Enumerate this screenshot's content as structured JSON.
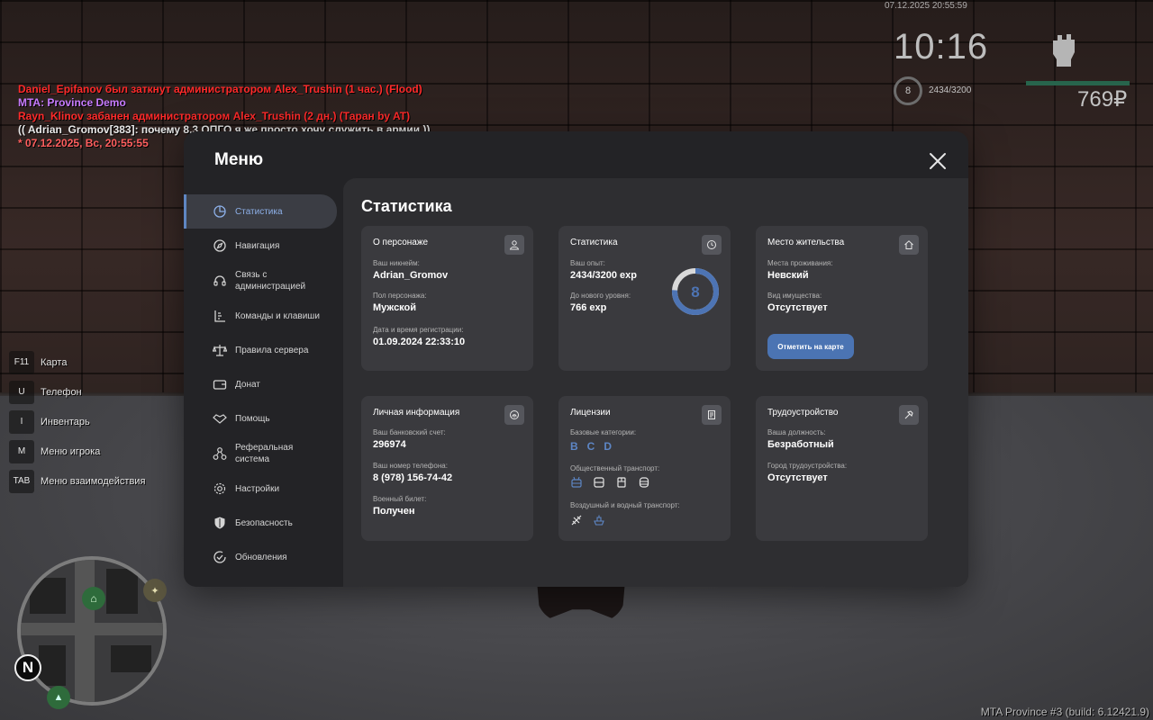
{
  "chat": [
    {
      "text": "Daniel_Epifanov был заткнут администратором Alex_Trushin (1 час.) (Flood)",
      "color": "#ff2a2a"
    },
    {
      "text": "MTA: Province Demo",
      "color": "#c77bff"
    },
    {
      "text": "Rayn_Klinov забанен администратором Alex_Trushin (2 дн.) (Таран by AT)",
      "color": "#ff2a2a"
    },
    {
      "text": "(( Adrian_Gromov[383]: почему 8.3 ОПГО я же просто хочу служить в армии ))",
      "color": "#e8e8e8"
    },
    {
      "text": "* 07.12.2025, Вс, 20:55:55",
      "color": "#ff5e5e"
    }
  ],
  "hud": {
    "datetime": "07.12.2025 20:55:59",
    "clock": "10:16",
    "level": "8",
    "exp": "2434/3200",
    "money": "769₽",
    "icon": "fist-icon"
  },
  "keybinds": [
    {
      "key": "F11",
      "label": "Карта"
    },
    {
      "key": "U",
      "label": "Телефон"
    },
    {
      "key": "I",
      "label": "Инвентарь"
    },
    {
      "key": "M",
      "label": "Меню игрока"
    },
    {
      "key": "TAB",
      "label": "Меню взаимодействия"
    }
  ],
  "minimap": {
    "compass": "N"
  },
  "build": "MTA Province #3 (build: 6.12421.9)",
  "menu": {
    "title": "Меню",
    "sidebar": [
      {
        "label": "Статистика",
        "icon": "pie-chart-icon",
        "active": true
      },
      {
        "label": "Навигация",
        "icon": "compass-icon"
      },
      {
        "label": "Связь с администрацией",
        "icon": "headset-icon"
      },
      {
        "label": "Команды и клавиши",
        "icon": "commands-icon"
      },
      {
        "label": "Правила сервера",
        "icon": "scales-icon"
      },
      {
        "label": "Донат",
        "icon": "wallet-icon"
      },
      {
        "label": "Помощь",
        "icon": "handshake-icon"
      },
      {
        "label": "Реферальная система",
        "icon": "referral-icon"
      },
      {
        "label": "Настройки",
        "icon": "gear-icon"
      },
      {
        "label": "Безопасность",
        "icon": "shield-icon"
      },
      {
        "label": "Обновления",
        "icon": "update-icon"
      }
    ],
    "content_title": "Статистика",
    "cards": {
      "character": {
        "title": "О персонаже",
        "nickname_label": "Ваш никнейм:",
        "nickname": "Adrian_Gromov",
        "gender_label": "Пол персонажа:",
        "gender": "Мужской",
        "reg_label": "Дата и время регистрации:",
        "reg": "01.09.2024 22:33:10"
      },
      "stats": {
        "title": "Статистика",
        "exp_label": "Ваш опыт:",
        "exp": "2434/3200 exp",
        "next_label": "До нового уровня:",
        "next": "766 exp",
        "level": "8",
        "progress": 0.76
      },
      "residence": {
        "title": "Место жительства",
        "place_label": "Места проживания:",
        "place": "Невский",
        "property_label": "Вид имущества:",
        "property": "Отсутствует",
        "button": "Отметить на карте"
      },
      "personal": {
        "title": "Личная информация",
        "bank_label": "Ваш банковский счет:",
        "bank": "296974",
        "phone_label": "Ваш номер телефона:",
        "phone": "8 (978) 156-74-42",
        "military_label": "Военный билет:",
        "military": "Получен"
      },
      "licenses": {
        "title": "Лицензии",
        "base_label": "Базовые категории:",
        "base": [
          "B",
          "C",
          "D"
        ],
        "public_label": "Общественный транспорт:",
        "public_icons": [
          "trolleybus-icon",
          "bus-icon",
          "tram-icon",
          "metro-icon"
        ],
        "air_label": "Воздушный и водный транспорт:",
        "air_icons": [
          "plane-icon",
          "boat-icon"
        ]
      },
      "employment": {
        "title": "Трудоустройство",
        "position_label": "Ваша должность:",
        "position": "Безработный",
        "city_label": "Город трудоустройства:",
        "city": "Отсутствует"
      }
    }
  }
}
